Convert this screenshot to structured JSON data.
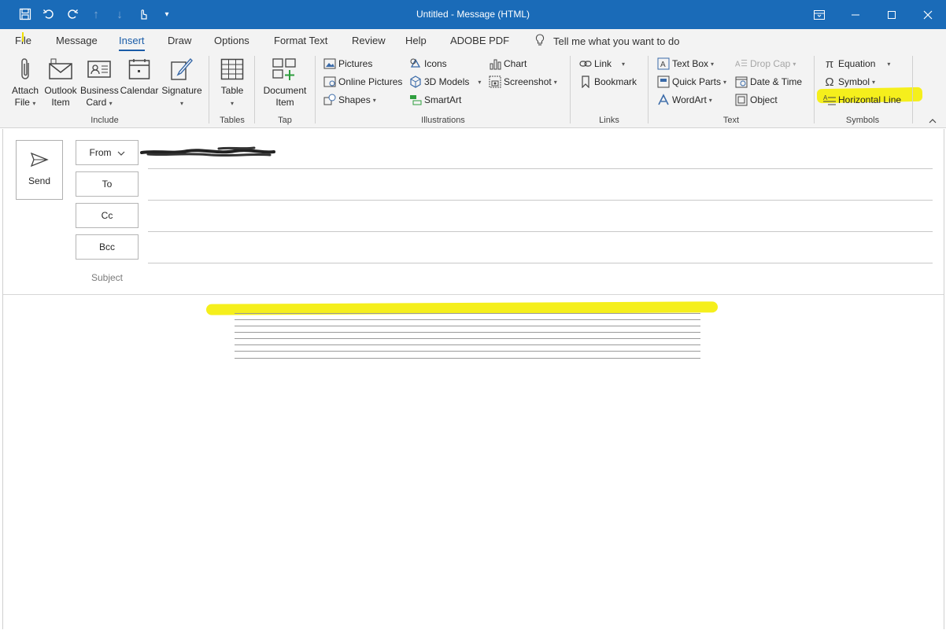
{
  "window": {
    "title": "Untitled  -  Message (HTML)"
  },
  "tabs": [
    {
      "label": "File"
    },
    {
      "label": "Message"
    },
    {
      "label": "Insert"
    },
    {
      "label": "Draw"
    },
    {
      "label": "Options"
    },
    {
      "label": "Format Text"
    },
    {
      "label": "Review"
    },
    {
      "label": "Help"
    },
    {
      "label": "ADOBE PDF"
    }
  ],
  "active_tab": "Insert",
  "tell_me": "Tell me what you want to do",
  "ribbon": {
    "include": {
      "label": "Include",
      "attach_file": [
        "Attach",
        "File"
      ],
      "outlook_item": [
        "Outlook",
        "Item"
      ],
      "business_card": [
        "Business",
        "Card"
      ],
      "calendar": "Calendar",
      "signature": "Signature"
    },
    "tables": {
      "label": "Tables",
      "table": "Table"
    },
    "tap": {
      "label": "Tap",
      "document_item": [
        "Document",
        "Item"
      ]
    },
    "illustrations": {
      "label": "Illustrations",
      "pictures": "Pictures",
      "online_pictures": "Online Pictures",
      "shapes": "Shapes",
      "icons": "Icons",
      "models_3d": "3D Models",
      "smartart": "SmartArt",
      "chart": "Chart",
      "screenshot": "Screenshot"
    },
    "links": {
      "label": "Links",
      "link": "Link",
      "bookmark": "Bookmark"
    },
    "text": {
      "label": "Text",
      "text_box": "Text Box",
      "quick_parts": "Quick Parts",
      "wordart": "WordArt",
      "drop_cap": "Drop Cap",
      "date_time": "Date & Time",
      "object": "Object"
    },
    "symbols": {
      "label": "Symbols",
      "equation": "Equation",
      "symbol": "Symbol",
      "horizontal_line": "Horizontal Line"
    }
  },
  "compose": {
    "send": "Send",
    "from": "From",
    "to": "To",
    "cc": "Cc",
    "bcc": "Bcc",
    "subject": "Subject"
  },
  "colors": {
    "titlebar": "#1a6bb8",
    "accent": "#1a5ca8",
    "highlight": "#f5ef1c"
  }
}
